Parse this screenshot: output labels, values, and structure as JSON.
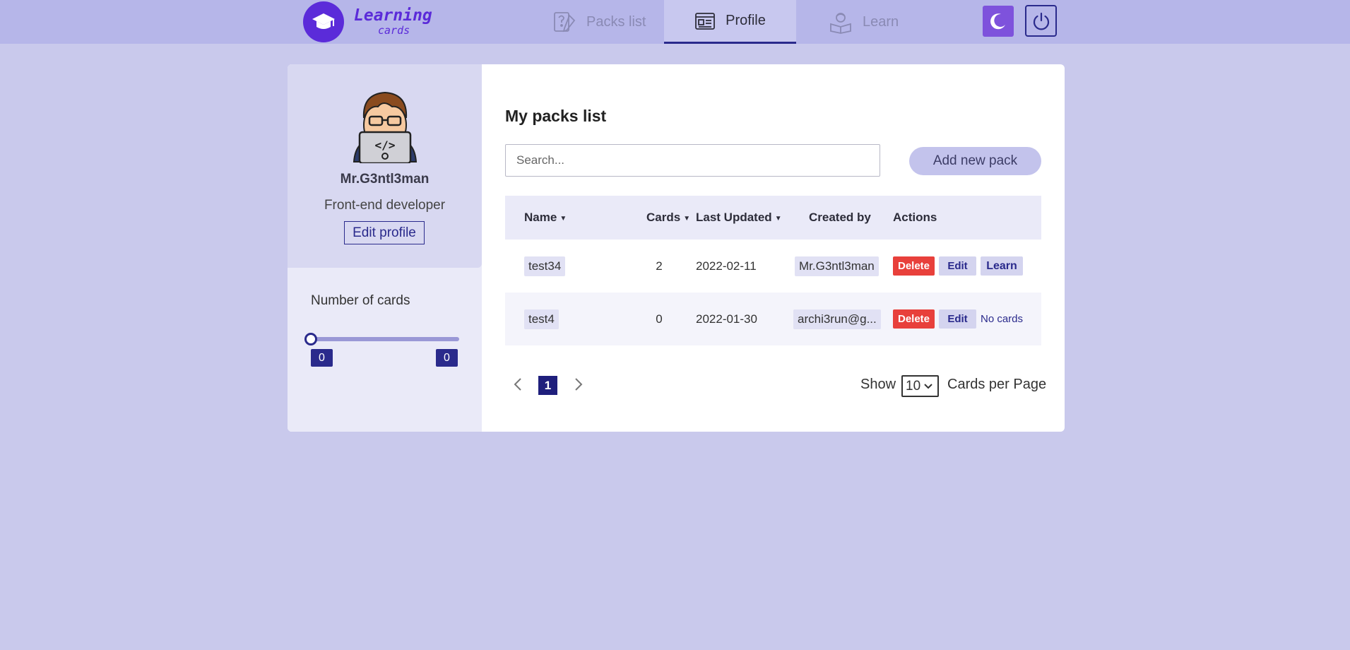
{
  "header": {
    "logo_line1": "Learning",
    "logo_line2": "cards",
    "tabs": [
      {
        "label": "Packs list",
        "icon": "packs-icon",
        "active": false
      },
      {
        "label": "Profile",
        "icon": "profile-icon",
        "active": true
      },
      {
        "label": "Learn",
        "icon": "learn-icon",
        "active": false
      }
    ],
    "theme_icon": "moon-icon",
    "logout_icon": "power-icon"
  },
  "profile": {
    "name": "Mr.G3ntl3man",
    "role": "Front-end developer",
    "edit_label": "Edit profile"
  },
  "filter": {
    "title": "Number of cards",
    "min": "0",
    "max": "0"
  },
  "packs": {
    "title": "My packs list",
    "search_placeholder": "Search...",
    "add_label": "Add new pack",
    "columns": [
      "Name",
      "Cards",
      "Last Updated",
      "Created by",
      "Actions"
    ],
    "rows": [
      {
        "name": "test34",
        "cards": "2",
        "updated": "2022-02-11",
        "created_by": "Mr.G3ntl3man",
        "delete": "Delete",
        "edit": "Edit",
        "learn": "Learn"
      },
      {
        "name": "test4",
        "cards": "0",
        "updated": "2022-01-30",
        "created_by": "archi3run@g...",
        "delete": "Delete",
        "edit": "Edit",
        "learn": "No cards"
      }
    ]
  },
  "pagination": {
    "current_page": "1",
    "show_label": "Show",
    "per_page": "10",
    "per_page_label": "Cards per Page"
  },
  "colors": {
    "background": "#c9c9ec",
    "header": "#b6b6e9",
    "accent": "#5b2bd9",
    "primary": "#2a2a8c",
    "delete": "#e8403b"
  }
}
